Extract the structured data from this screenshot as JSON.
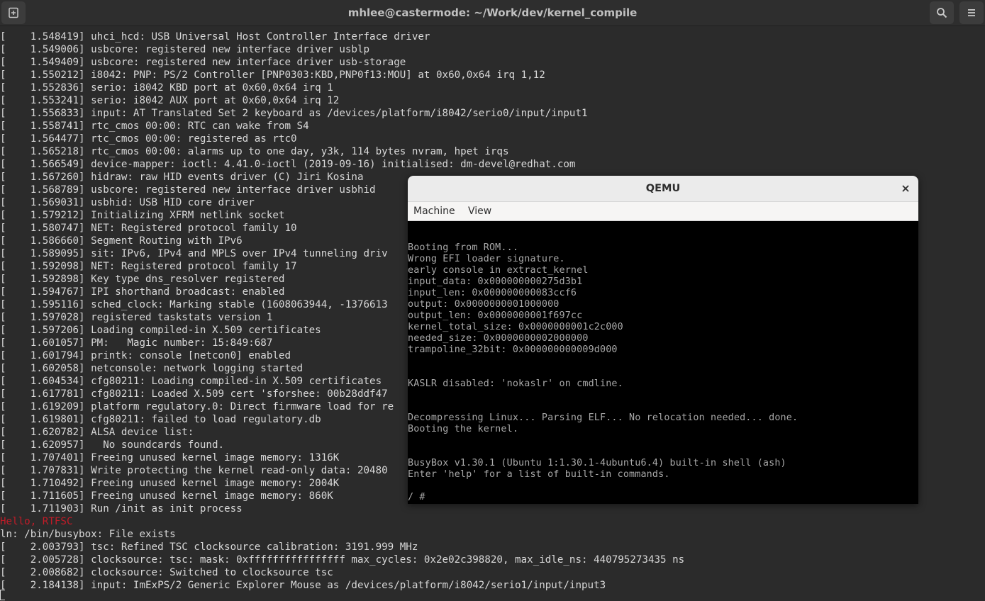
{
  "terminal": {
    "title": "mhlee@castermode: ~/Work/dev/kernel_compile",
    "lines": [
      {
        "text": "[    1.548419] uhci_hcd: USB Universal Host Controller Interface driver",
        "color": "default"
      },
      {
        "text": "[    1.549006] usbcore: registered new interface driver usblp",
        "color": "default"
      },
      {
        "text": "[    1.549409] usbcore: registered new interface driver usb-storage",
        "color": "default"
      },
      {
        "text": "[    1.550212] i8042: PNP: PS/2 Controller [PNP0303:KBD,PNP0f13:MOU] at 0x60,0x64 irq 1,12",
        "color": "default"
      },
      {
        "text": "[    1.552836] serio: i8042 KBD port at 0x60,0x64 irq 1",
        "color": "default"
      },
      {
        "text": "[    1.553241] serio: i8042 AUX port at 0x60,0x64 irq 12",
        "color": "default"
      },
      {
        "text": "[    1.556833] input: AT Translated Set 2 keyboard as /devices/platform/i8042/serio0/input/input1",
        "color": "default"
      },
      {
        "text": "[    1.558741] rtc_cmos 00:00: RTC can wake from S4",
        "color": "default"
      },
      {
        "text": "[    1.564477] rtc_cmos 00:00: registered as rtc0",
        "color": "default"
      },
      {
        "text": "[    1.565218] rtc_cmos 00:00: alarms up to one day, y3k, 114 bytes nvram, hpet irqs",
        "color": "default"
      },
      {
        "text": "[    1.566549] device-mapper: ioctl: 4.41.0-ioctl (2019-09-16) initialised: dm-devel@redhat.com",
        "color": "default"
      },
      {
        "text": "[    1.567260] hidraw: raw HID events driver (C) Jiri Kosina",
        "color": "default"
      },
      {
        "text": "[    1.568789] usbcore: registered new interface driver usbhid",
        "color": "default"
      },
      {
        "text": "[    1.569031] usbhid: USB HID core driver",
        "color": "default"
      },
      {
        "text": "[    1.579212] Initializing XFRM netlink socket",
        "color": "default"
      },
      {
        "text": "[    1.580747] NET: Registered protocol family 10",
        "color": "default"
      },
      {
        "text": "[    1.586660] Segment Routing with IPv6",
        "color": "default"
      },
      {
        "text": "[    1.589095] sit: IPv6, IPv4 and MPLS over IPv4 tunneling driv",
        "color": "default"
      },
      {
        "text": "[    1.592098] NET: Registered protocol family 17",
        "color": "default"
      },
      {
        "text": "[    1.592898] Key type dns_resolver registered",
        "color": "default"
      },
      {
        "text": "[    1.594767] IPI shorthand broadcast: enabled",
        "color": "default"
      },
      {
        "text": "[    1.595116] sched_clock: Marking stable (1608063944, -1376613",
        "color": "default"
      },
      {
        "text": "[    1.597028] registered taskstats version 1",
        "color": "default"
      },
      {
        "text": "[    1.597206] Loading compiled-in X.509 certificates",
        "color": "default"
      },
      {
        "text": "[    1.601057] PM:   Magic number: 15:849:687",
        "color": "default"
      },
      {
        "text": "[    1.601794] printk: console [netcon0] enabled",
        "color": "default"
      },
      {
        "text": "[    1.602058] netconsole: network logging started",
        "color": "default"
      },
      {
        "text": "[    1.604534] cfg80211: Loading compiled-in X.509 certificates",
        "color": "default"
      },
      {
        "text": "[    1.617781] cfg80211: Loaded X.509 cert 'sforshee: 00b28ddf47",
        "color": "default"
      },
      {
        "text": "[    1.619209] platform regulatory.0: Direct firmware load for re",
        "color": "default"
      },
      {
        "text": "[    1.619801] cfg80211: failed to load regulatory.db",
        "color": "default"
      },
      {
        "text": "[    1.620782] ALSA device list:",
        "color": "default"
      },
      {
        "text": "[    1.620957]   No soundcards found.",
        "color": "default"
      },
      {
        "text": "[    1.707401] Freeing unused kernel image memory: 1316K",
        "color": "default"
      },
      {
        "text": "[    1.707831] Write protecting the kernel read-only data: 20480",
        "color": "default"
      },
      {
        "text": "[    1.710492] Freeing unused kernel image memory: 2004K",
        "color": "default"
      },
      {
        "text": "[    1.711605] Freeing unused kernel image memory: 860K",
        "color": "default"
      },
      {
        "text": "[    1.711903] Run /init as init process",
        "color": "default"
      },
      {
        "text": "Hello, RTFSC",
        "color": "red"
      },
      {
        "text": "ln: /bin/busybox: File exists",
        "color": "default"
      },
      {
        "text": "[    2.003793] tsc: Refined TSC clocksource calibration: 3191.999 MHz",
        "color": "default"
      },
      {
        "text": "[    2.005728] clocksource: tsc: mask: 0xffffffffffffffff max_cycles: 0x2e02c398820, max_idle_ns: 440795273435 ns",
        "color": "default"
      },
      {
        "text": "[    2.008682] clocksource: Switched to clocksource tsc",
        "color": "default"
      },
      {
        "text": "[    2.184138] input: ImExPS/2 Generic Explorer Mouse as /devices/platform/i8042/serio1/input/input3",
        "color": "default"
      }
    ]
  },
  "qemu": {
    "title": "QEMU",
    "menu": [
      "Machine",
      "View"
    ],
    "screen_lines": [
      "Booting from ROM...",
      "Wrong EFI loader signature.",
      "early console in extract_kernel",
      "input_data: 0x000000000275d3b1",
      "input_len: 0x000000000083ccf6",
      "output: 0x0000000001000000",
      "output_len: 0x0000000001f697cc",
      "kernel_total_size: 0x0000000001c2c000",
      "needed_size: 0x0000000002000000",
      "trampoline_32bit: 0x000000000009d000",
      "",
      "",
      "KASLR disabled: 'nokaslr' on cmdline.",
      "",
      "",
      "Decompressing Linux... Parsing ELF... No relocation needed... done.",
      "Booting the kernel.",
      "",
      "",
      "BusyBox v1.30.1 (Ubuntu 1:1.30.1-4ubuntu6.4) built-in shell (ash)",
      "Enter 'help' for a list of built-in commands.",
      "",
      "/ #"
    ]
  },
  "colors": {
    "terminal_bg": "#2b2b2b",
    "terminal_fg": "#d8d8d8",
    "terminal_red": "#c01c28",
    "qemu_screen_fg": "#a8a8a8"
  },
  "icons": {
    "new_tab": "new-tab-icon",
    "search": "search-icon",
    "menu": "hamburger-menu-icon",
    "close": "close-icon"
  }
}
